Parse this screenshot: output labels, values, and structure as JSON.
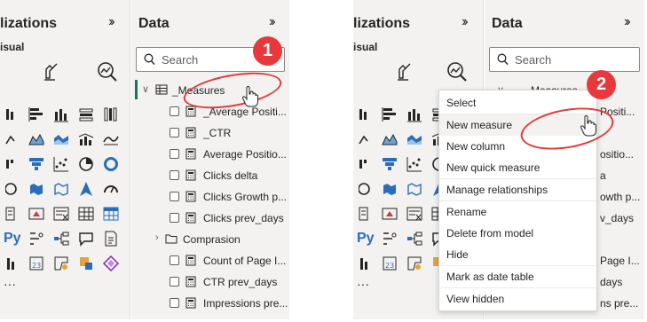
{
  "panel1": {
    "visualizations": {
      "title": "lizations",
      "subtitle": "isual"
    },
    "data": {
      "title": "Data",
      "search_placeholder": "Search",
      "tree": [
        {
          "label": "_Measures",
          "type": "table",
          "expanded": true
        },
        {
          "label": "_Average Positi...",
          "type": "measure"
        },
        {
          "label": "_CTR",
          "type": "measure"
        },
        {
          "label": "Average Positio...",
          "type": "measure"
        },
        {
          "label": "Clicks delta",
          "type": "measure"
        },
        {
          "label": "Clicks Growth p...",
          "type": "measure"
        },
        {
          "label": "Clicks prev_days",
          "type": "measure"
        },
        {
          "label": "Comprasion",
          "type": "folder",
          "expanded": false
        },
        {
          "label": "Count of Page I...",
          "type": "measure"
        },
        {
          "label": "CTR prev_days",
          "type": "measure"
        },
        {
          "label": "Impressions pre...",
          "type": "measure"
        }
      ]
    },
    "step_badge": "1"
  },
  "panel2": {
    "visualizations": {
      "title": "lizations",
      "subtitle": "isual"
    },
    "data": {
      "title": "Data",
      "search_placeholder": "Search",
      "tree_header": "Measures",
      "behind_labels": [
        "Positi...",
        "ositio...",
        "a",
        "owth p...",
        "v_days",
        "Page I...",
        "days",
        "ns pre..."
      ]
    },
    "context_menu": [
      "Select",
      "New measure",
      "New column",
      "New quick measure",
      "Manage relationships",
      "Rename",
      "Delete from model",
      "Hide",
      "Mark as date table",
      "View hidden"
    ],
    "step_badge": "2"
  },
  "colors": {
    "pane_bg": "#f3f2f1",
    "selection_accent": "#117865",
    "annotation_red": "#e03a3a",
    "badge_red": "#e8383c"
  }
}
